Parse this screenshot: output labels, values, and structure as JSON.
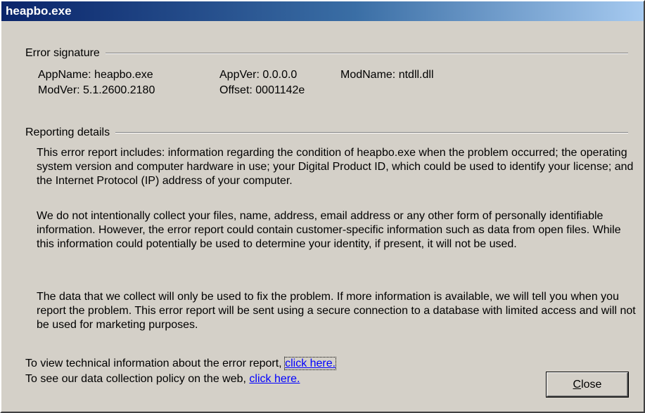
{
  "window": {
    "title": "heapbo.exe"
  },
  "error_signature": {
    "heading": "Error signature",
    "app_name": "AppName: heapbo.exe",
    "app_ver": "AppVer: 0.0.0.0",
    "mod_name": "ModName: ntdll.dll",
    "mod_ver": "ModVer: 5.1.2600.2180",
    "offset": "Offset: 0001142e"
  },
  "reporting_details": {
    "heading": "Reporting details",
    "paragraphs": [
      "This error report includes: information regarding the condition of heapbo.exe when the problem occurred; the operating system version and computer hardware in use; your Digital Product ID, which could be used to identify your license; and the Internet Protocol (IP) address of your computer.",
      "We do not intentionally collect your files, name, address, email address or any other form of personally identifiable information. However, the error report could contain customer-specific information such as data from open files. While this information could potentially be used to determine your identity, if present, it will not be used.",
      "The data that we collect will only be used to fix the problem. If more information is available, we will tell you when you report the problem. This error report will be sent using a secure connection to a database with limited access and will not be used for marketing purposes."
    ]
  },
  "links": {
    "technical_prefix": "To view technical information about the error report, ",
    "technical_link": "click here.",
    "policy_prefix": "To see our data collection policy on the web, ",
    "policy_link": "click here."
  },
  "buttons": {
    "close_accel": "C",
    "close_rest": "lose"
  }
}
